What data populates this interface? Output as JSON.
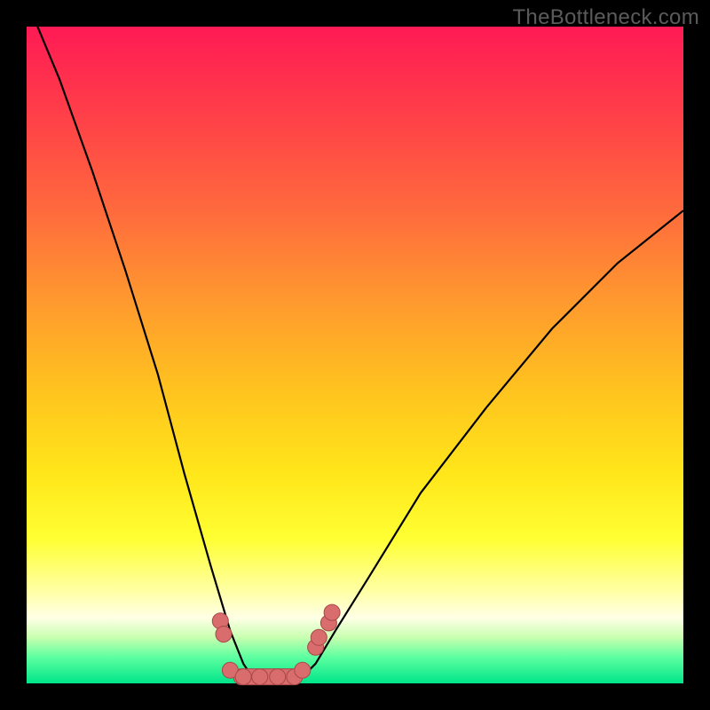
{
  "watermark": "TheBottleneck.com",
  "chart_data": {
    "type": "line",
    "title": "",
    "xlabel": "",
    "ylabel": "",
    "series": [
      {
        "name": "curve",
        "x": [
          0.0,
          0.05,
          0.1,
          0.15,
          0.2,
          0.24,
          0.28,
          0.31,
          0.33,
          0.35,
          0.38,
          0.41,
          0.44,
          0.47,
          0.52,
          0.6,
          0.7,
          0.8,
          0.9,
          1.0
        ],
        "y": [
          1.04,
          0.92,
          0.78,
          0.63,
          0.47,
          0.32,
          0.18,
          0.08,
          0.03,
          0.0,
          0.0,
          0.0,
          0.03,
          0.08,
          0.16,
          0.29,
          0.42,
          0.54,
          0.64,
          0.72
        ]
      },
      {
        "name": "markers",
        "x": [
          0.295,
          0.3,
          0.31,
          0.33,
          0.355,
          0.382,
          0.408,
          0.42,
          0.44,
          0.445,
          0.46,
          0.465
        ],
        "y": [
          0.095,
          0.075,
          0.02,
          0.01,
          0.01,
          0.01,
          0.01,
          0.02,
          0.055,
          0.07,
          0.092,
          0.108
        ]
      }
    ],
    "xlim": [
      0,
      1
    ],
    "ylim": [
      0,
      1
    ],
    "colors": {
      "curve": "#000000",
      "marker_fill": "#d96c6c",
      "marker_stroke": "#a84848"
    }
  }
}
